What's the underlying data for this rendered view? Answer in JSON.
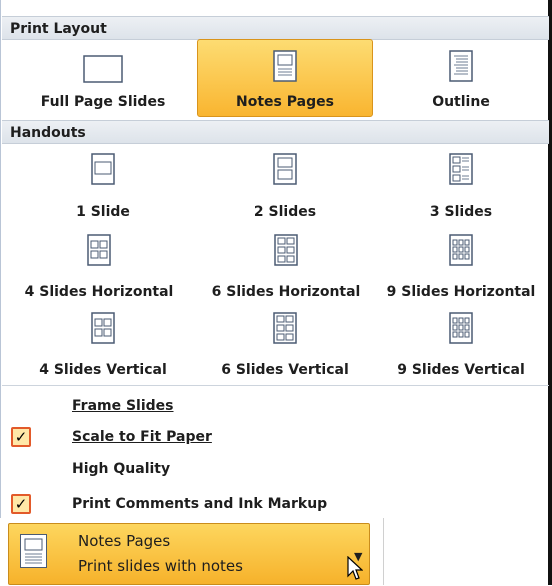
{
  "print_layout": {
    "header": "Print Layout",
    "options": [
      {
        "label": "Full Page Slides",
        "icon": "full-page-slide-icon"
      },
      {
        "label": "Notes Pages",
        "icon": "notes-pages-icon",
        "selected": true
      },
      {
        "label": "Outline",
        "icon": "outline-icon"
      }
    ]
  },
  "handouts": {
    "header": "Handouts",
    "options": [
      {
        "label": "1 Slide",
        "icon": "one-slide-icon"
      },
      {
        "label": "2 Slides",
        "icon": "two-slides-icon"
      },
      {
        "label": "3 Slides",
        "icon": "three-slides-icon"
      },
      {
        "label": "4 Slides Horizontal",
        "icon": "four-slides-horizontal-icon"
      },
      {
        "label": "6 Slides Horizontal",
        "icon": "six-slides-horizontal-icon"
      },
      {
        "label": "9 Slides Horizontal",
        "icon": "nine-slides-horizontal-icon"
      },
      {
        "label": "4 Slides Vertical",
        "icon": "four-slides-vertical-icon"
      },
      {
        "label": "6 Slides Vertical",
        "icon": "six-slides-vertical-icon"
      },
      {
        "label": "9 Slides Vertical",
        "icon": "nine-slides-vertical-icon"
      }
    ]
  },
  "toggles": [
    {
      "label": "Frame Slides",
      "checked": false
    },
    {
      "label": "Scale to Fit Paper",
      "checked": true
    },
    {
      "label": "High Quality",
      "checked": false
    },
    {
      "label": "Print Comments and Ink Markup",
      "checked": true
    }
  ],
  "dropdown": {
    "title": "Notes Pages",
    "subtitle": "Print slides with notes",
    "icon": "notes-pages-icon"
  },
  "colors": {
    "selected_fill": "#f9b530",
    "header_bg": "#dde3ea",
    "check_border": "#e25a2a"
  }
}
